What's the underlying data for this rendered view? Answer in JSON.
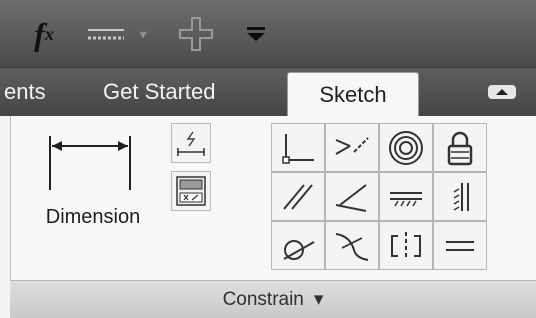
{
  "quick_access": {
    "fx_label": "f",
    "fx_sub": "x",
    "icons": [
      "fx-icon",
      "line-style-icon",
      "dropdown-arrow-icon",
      "plus-icon",
      "customize-arrow-icon"
    ]
  },
  "tabs": {
    "prev_label": "ents",
    "get_started_label": "Get Started",
    "sketch_label": "Sketch"
  },
  "panel": {
    "dimension_label": "Dimension",
    "title": "Constrain",
    "title_arrow": "▾",
    "constraint_icons": [
      "coincident-icon",
      "collinear-icon",
      "concentric-icon",
      "fix-icon",
      "parallel-icon",
      "perpendicular-icon",
      "horizontal-icon",
      "vertical-icon",
      "tangent-icon",
      "smooth-icon",
      "symmetric-icon",
      "equal-icon"
    ]
  },
  "colors": {
    "ribbon_dark": "#4a4a4a",
    "panel_bg": "#f7f7f7",
    "icon_stroke": "#333333"
  }
}
